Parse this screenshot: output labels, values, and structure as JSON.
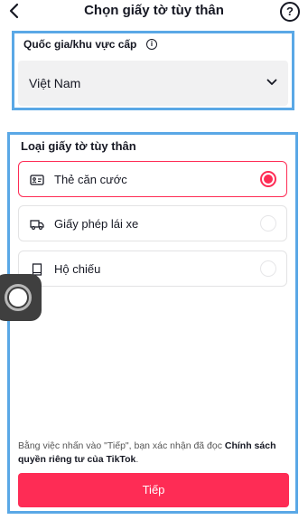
{
  "header": {
    "title": "Chọn giấy tờ tùy thân",
    "help_glyph": "?"
  },
  "country": {
    "label": "Quốc gia/khu vực cấp",
    "info_glyph": "i",
    "value": "Việt Nam"
  },
  "document": {
    "label": "Loại giấy tờ tùy thân",
    "options": [
      {
        "label": "Thẻ căn cước",
        "icon": "id-card-icon",
        "selected": true
      },
      {
        "label": "Giấy phép lái xe",
        "icon": "truck-icon",
        "selected": false
      },
      {
        "label": "Hộ chiếu",
        "icon": "passport-icon",
        "selected": false
      }
    ]
  },
  "consent": {
    "text": "Bằng việc nhấn vào \"Tiếp\", bạn xác nhận đã đọc ",
    "link": "Chính sách quyền riêng tư của TikTok",
    "end": "."
  },
  "next_button": "Tiếp",
  "colors": {
    "accent": "#fe2c55",
    "highlight_border": "#5aa8e6",
    "select_bg": "#f1f1f2"
  }
}
